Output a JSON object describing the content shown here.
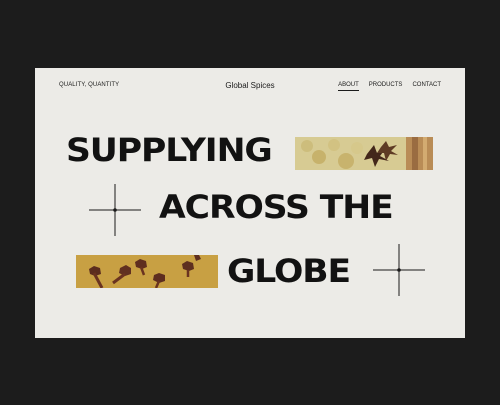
{
  "header": {
    "tagline": "QUALITY, QUANTITY",
    "brand": "Global Spices",
    "nav": [
      {
        "label": "ABOUT",
        "active": true
      },
      {
        "label": "PRODUCTS",
        "active": false
      },
      {
        "label": "CONTACT",
        "active": false
      }
    ]
  },
  "hero": {
    "lines": [
      "SUPPLYING",
      "ACROSS THE",
      "GLOBE"
    ]
  }
}
